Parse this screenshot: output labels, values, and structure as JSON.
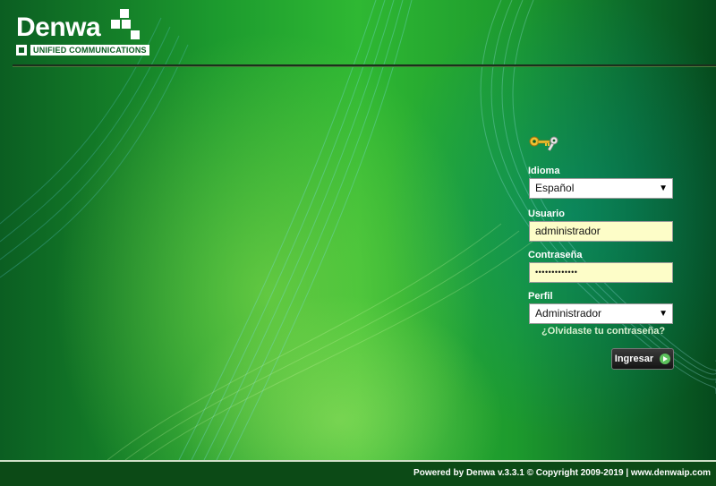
{
  "brand": {
    "name": "Denwa",
    "tagline": "UNIFIED COMMUNICATIONS"
  },
  "login": {
    "icon": "keys-icon",
    "language_label": "Idioma",
    "language_value": "Español",
    "user_label": "Usuario",
    "user_value": "administrador",
    "password_label": "Contraseña",
    "password_value": "•••••••••••••",
    "profile_label": "Perfil",
    "profile_value": "Administrador",
    "forgot_link": "¿Olvidaste tu contraseña?",
    "submit_label": "Ingresar"
  },
  "footer": {
    "text": "Powered by Denwa v.3.3.1 © Copyright 2009-2019 | www.denwaip.com"
  },
  "colors": {
    "background_green": "#1c9a2e",
    "input_yellow": "#fdfdc8",
    "footer_bg": "#0c4a16"
  }
}
